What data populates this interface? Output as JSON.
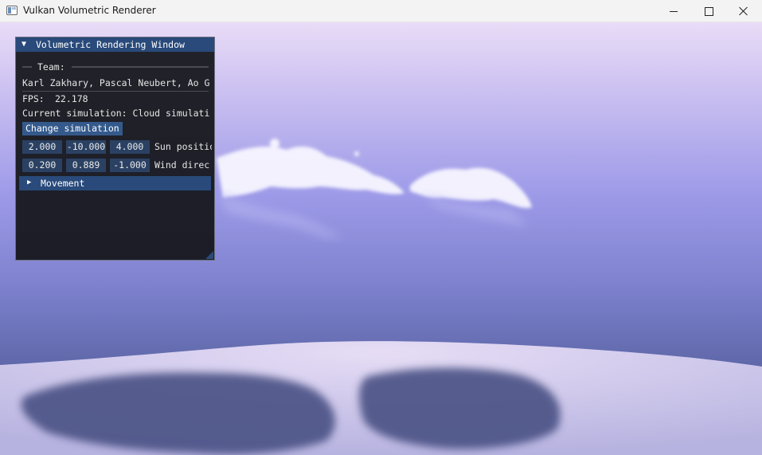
{
  "window": {
    "title": "Vulkan Volumetric Renderer"
  },
  "panel": {
    "title": "Volumetric Rendering Window",
    "team_label": "Team:",
    "team_members": "Karl Zakhary, Pascal Neubert, Ao G",
    "fps_label": "FPS:",
    "fps_value": "22.178",
    "current_simulation": "Current simulation: Cloud simulati",
    "change_button": "Change simulation",
    "sun_position": {
      "label": "Sun positio",
      "x": "2.000",
      "y": "-10.000",
      "z": "4.000"
    },
    "wind_direction": {
      "label": "Wind direc",
      "x": "0.200",
      "y": "0.889",
      "z": "-1.000"
    },
    "movement_header": "Movement"
  },
  "colors": {
    "title_bar": "#294a7a",
    "button": "#345a8c",
    "field_bg": "#2b4163",
    "highlight": "#3d7fd1"
  }
}
